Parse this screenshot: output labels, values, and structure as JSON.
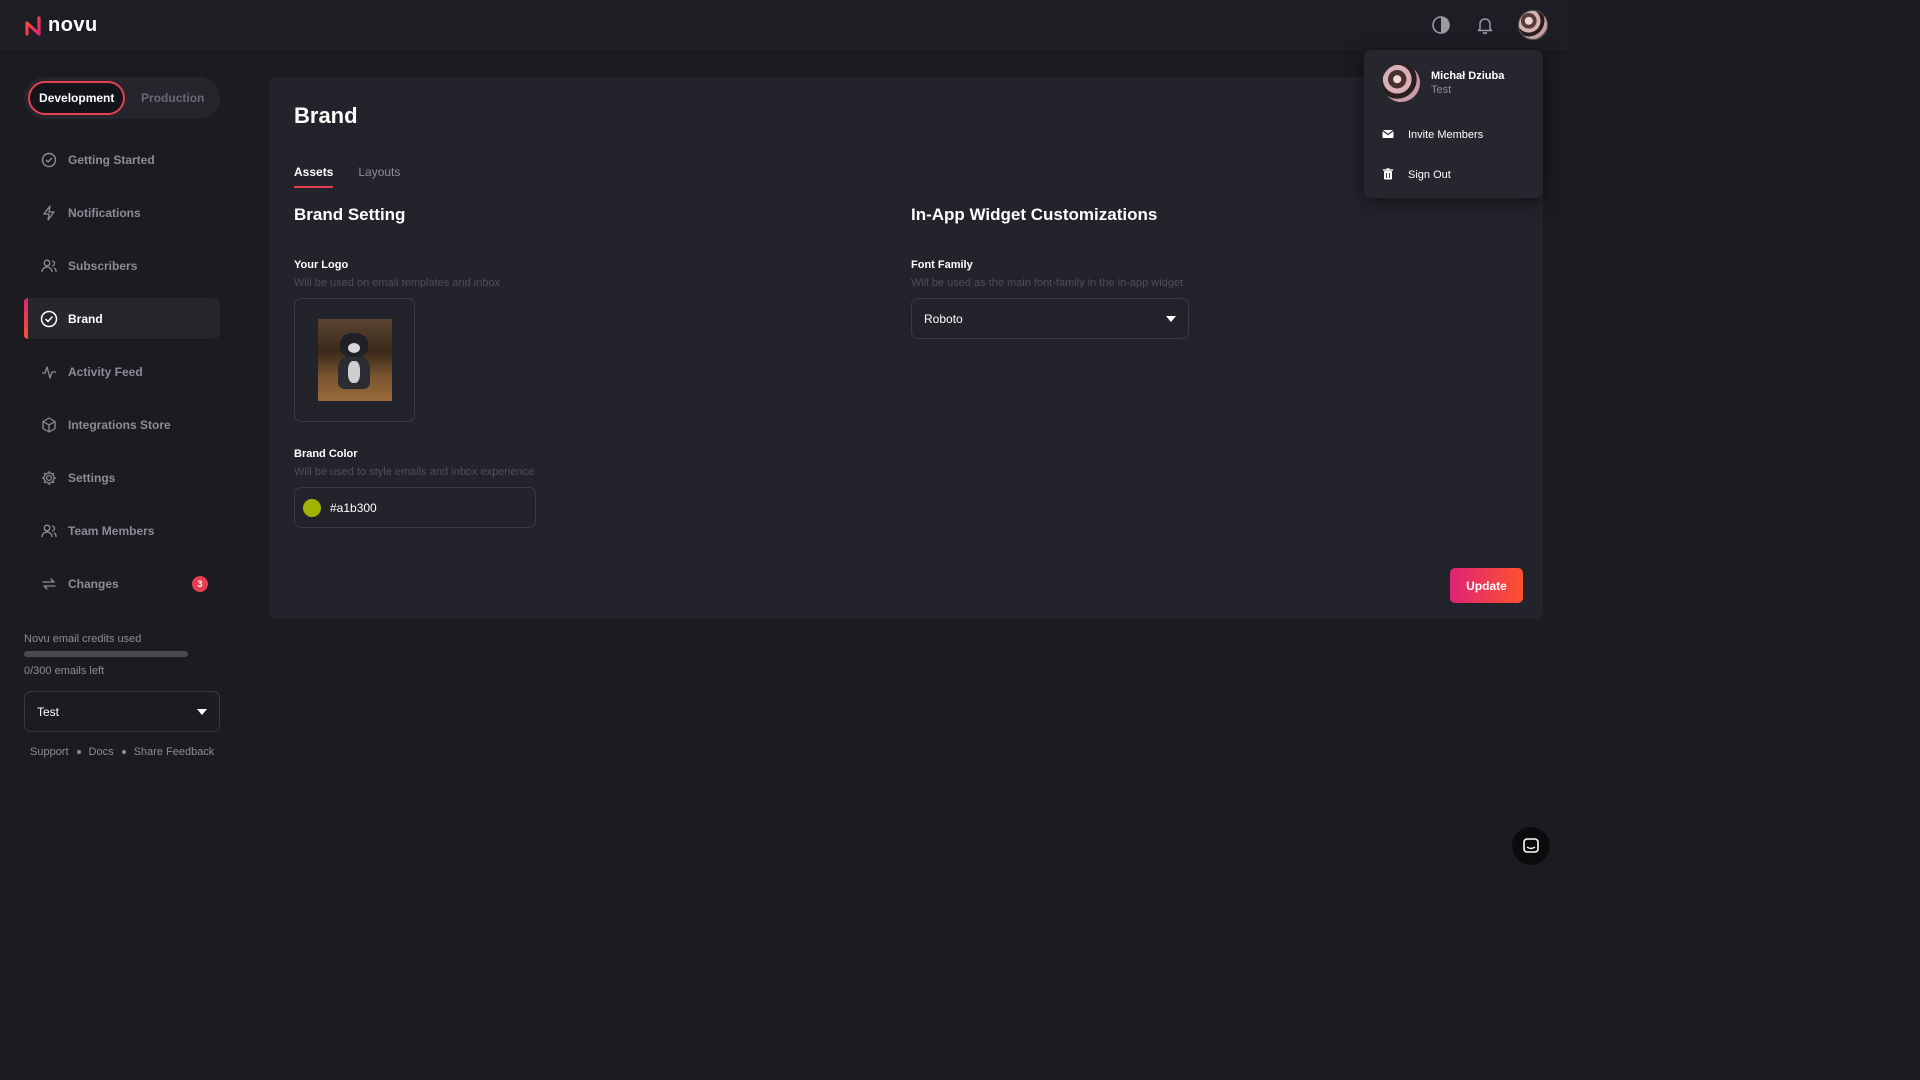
{
  "app": {
    "name": "novu"
  },
  "header": {
    "icons": [
      "theme-toggle-icon",
      "bell-icon",
      "avatar"
    ]
  },
  "environment": {
    "active": "Development",
    "inactive": "Production"
  },
  "sidebar": {
    "items": [
      {
        "label": "Getting Started",
        "icon": "check-circle-icon"
      },
      {
        "label": "Notifications",
        "icon": "bolt-icon"
      },
      {
        "label": "Subscribers",
        "icon": "users-icon"
      },
      {
        "label": "Brand",
        "icon": "badge-check-icon",
        "active": true
      },
      {
        "label": "Activity Feed",
        "icon": "activity-icon"
      },
      {
        "label": "Integrations Store",
        "icon": "box-icon"
      },
      {
        "label": "Settings",
        "icon": "gear-icon"
      },
      {
        "label": "Team Members",
        "icon": "team-icon"
      },
      {
        "label": "Changes",
        "icon": "changes-icon",
        "badge": "3"
      }
    ]
  },
  "credits": {
    "title": "Novu email credits used",
    "used_fraction": 0,
    "left_text": "0/300 emails left"
  },
  "org_select": {
    "value": "Test"
  },
  "footer": {
    "support": "Support",
    "docs": "Docs",
    "feedback": "Share Feedback"
  },
  "page": {
    "title": "Brand",
    "tabs": [
      {
        "label": "Assets",
        "active": true
      },
      {
        "label": "Layouts"
      }
    ],
    "brand_setting": {
      "title": "Brand Setting",
      "logo_label": "Your Logo",
      "logo_desc": "Will be used on email templates and inbox",
      "color_label": "Brand Color",
      "color_desc": "Will be used to style emails and inbox experience",
      "color_value": "#a1b300"
    },
    "widget": {
      "title": "In-App Widget Customizations",
      "font_label": "Font Family",
      "font_desc": "Will be used as the main font-family in the in-app widget",
      "font_value": "Roboto"
    },
    "update_label": "Update"
  },
  "user_menu": {
    "name": "Michał Dziuba",
    "org": "Test",
    "invite": "Invite Members",
    "signout": "Sign Out"
  },
  "colors": {
    "accent": "#e5404f",
    "brand_color": "#a1b300"
  }
}
